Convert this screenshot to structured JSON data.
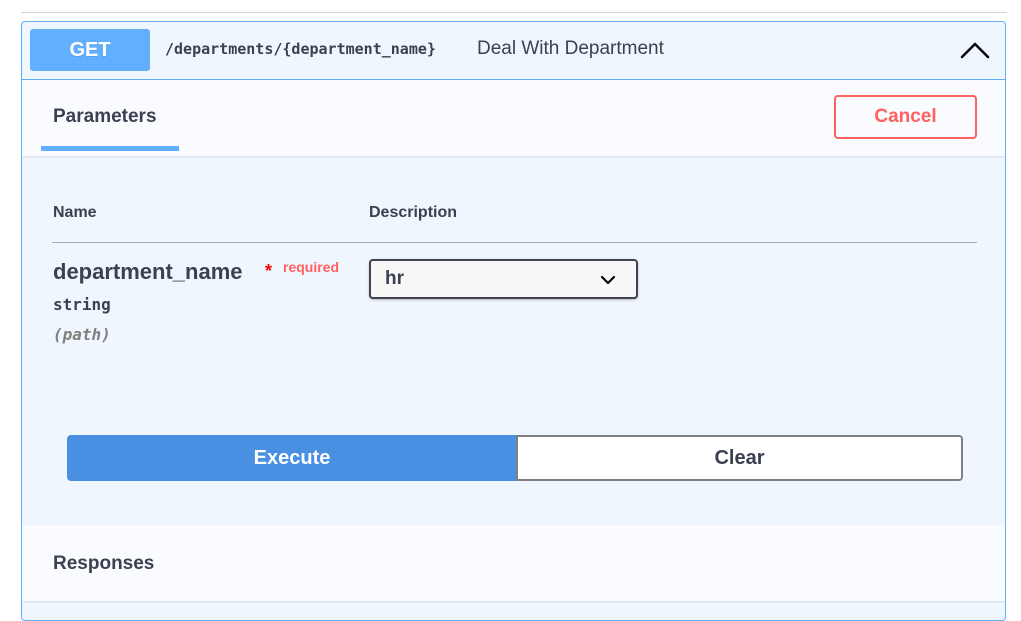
{
  "endpoint": {
    "method": "GET",
    "path": "/departments/{department_name}",
    "summary": "Deal With Department",
    "collapse_icon": "chevron-up-icon"
  },
  "parameters_section": {
    "tab_label": "Parameters",
    "cancel_label": "Cancel",
    "columns": {
      "name": "Name",
      "description": "Description"
    },
    "params": [
      {
        "name": "department_name",
        "required_star": "*",
        "required_label": "required",
        "type": "string",
        "in": "(path)",
        "selected_value": "hr",
        "select_icon": "chevron-down-icon"
      }
    ]
  },
  "actions": {
    "execute_label": "Execute",
    "clear_label": "Clear"
  },
  "responses": {
    "title": "Responses"
  },
  "colors": {
    "get_blue": "#61affe",
    "execute_blue": "#4990e2",
    "cancel_red": "#ff6060",
    "required_red": "#ff0000",
    "text_dark": "#3b4151"
  }
}
